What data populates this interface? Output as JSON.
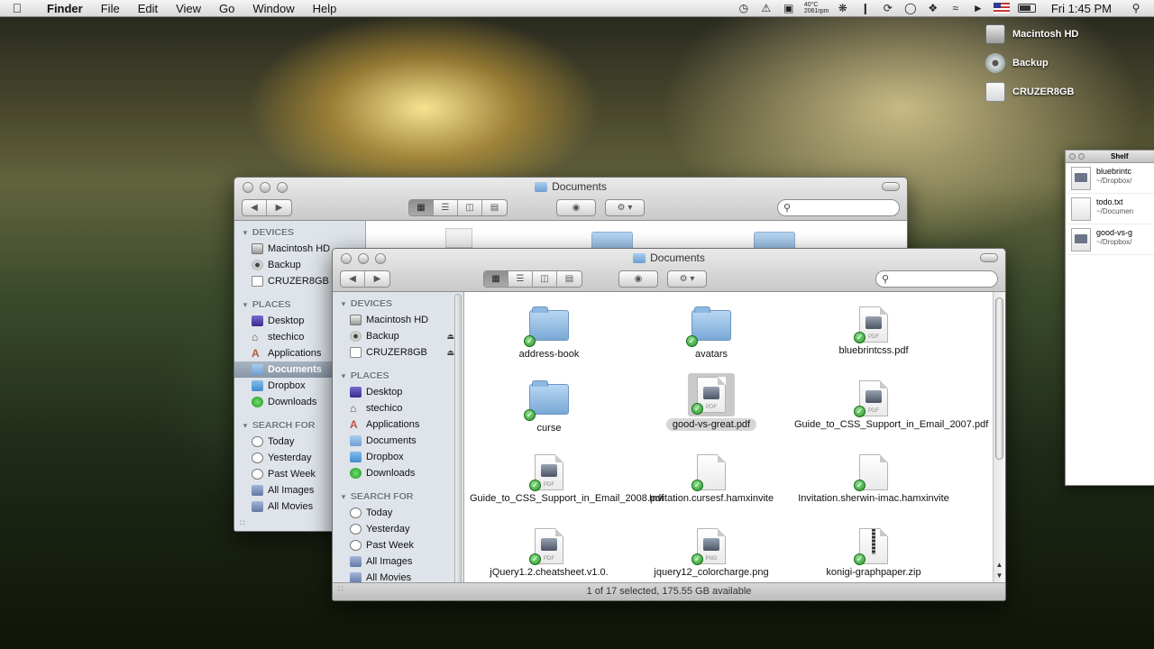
{
  "menubar": {
    "app_name": "Finder",
    "menus": [
      "File",
      "Edit",
      "View",
      "Go",
      "Window",
      "Help"
    ],
    "temp_top": "40°C",
    "temp_bottom": "2061rpm",
    "clock": "Fri 1:45 PM"
  },
  "desktop": {
    "drives": [
      "Macintosh HD",
      "Backup",
      "CRUZER8GB"
    ]
  },
  "back_window": {
    "title": "Documents",
    "devices_label": "DEVICES",
    "devices": [
      "Macintosh HD",
      "Backup",
      "CRUZER8GB"
    ],
    "places_label": "PLACES",
    "places": [
      "Desktop",
      "stechico",
      "Applications",
      "Documents",
      "Dropbox",
      "Downloads"
    ],
    "selected_place": "Documents",
    "search_label": "SEARCH FOR",
    "searches": [
      "Today",
      "Yesterday",
      "Past Week",
      "All Images",
      "All Movies"
    ]
  },
  "front_window": {
    "title": "Documents",
    "devices_label": "DEVICES",
    "devices": [
      "Macintosh HD",
      "Backup",
      "CRUZER8GB"
    ],
    "places_label": "PLACES",
    "places": [
      "Desktop",
      "stechico",
      "Applications",
      "Documents",
      "Dropbox",
      "Downloads"
    ],
    "search_label": "SEARCH FOR",
    "searches": [
      "Today",
      "Yesterday",
      "Past Week",
      "All Images",
      "All Movies"
    ],
    "files": [
      {
        "name": "address-book",
        "kind": "folder"
      },
      {
        "name": "avatars",
        "kind": "folder"
      },
      {
        "name": "bluebrintcss.pdf",
        "kind": "pdf"
      },
      {
        "name": "curse",
        "kind": "folder"
      },
      {
        "name": "good-vs-great.pdf",
        "kind": "pdf",
        "selected": true
      },
      {
        "name": "Guide_to_CSS_Support_in_Email_2007.pdf",
        "kind": "pdf"
      },
      {
        "name": "Guide_to_CSS_Support_in_Email_2008.pdf",
        "kind": "pdf"
      },
      {
        "name": "Invitation.cursesf.hamxinvite",
        "kind": "doc"
      },
      {
        "name": "Invitation.sherwin-imac.hamxinvite",
        "kind": "doc"
      },
      {
        "name": "jQuery1.2.cheatsheet.v1.0.",
        "kind": "pdf"
      },
      {
        "name": "jquery12_colorcharge.png",
        "kind": "png"
      },
      {
        "name": "konigi-graphpaper.zip",
        "kind": "zip"
      }
    ],
    "status": "1 of 17 selected, 175.55 GB available"
  },
  "shelf": {
    "title": "Shelf",
    "items": [
      {
        "name": "bluebrintc",
        "path": "~/Dropbox/"
      },
      {
        "name": "todo.txt",
        "path": "~/Documen"
      },
      {
        "name": "good-vs-g",
        "path": "~/Dropbox/"
      }
    ]
  }
}
